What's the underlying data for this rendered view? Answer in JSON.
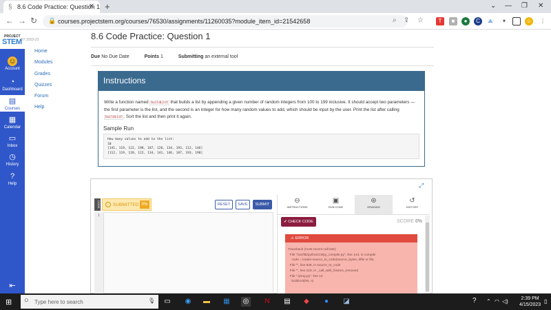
{
  "browser": {
    "tab_title": "8.6 Code Practice: Question 1",
    "url": "courses.projectstem.org/courses/76530/assignments/11260035?module_item_id=21542658"
  },
  "brand": {
    "line1": "PROJECT",
    "line2": "STEM"
  },
  "global_nav": {
    "account": "Account",
    "dashboard": "Dashboard",
    "courses": "Courses",
    "calendar": "Calendar",
    "inbox": "Inbox",
    "history": "History",
    "help": "Help"
  },
  "course_nav": {
    "term": "SY 2022-23",
    "items": [
      "Home",
      "Modules",
      "Grades",
      "Quizzes",
      "Forum",
      "Help"
    ]
  },
  "page": {
    "title": "8.6 Code Practice: Question 1",
    "due_label": "Due",
    "due_value": "No Due Date",
    "points_label": "Points",
    "points_value": "1",
    "submitting_label": "Submitting",
    "submitting_value": "an external tool"
  },
  "instructions": {
    "heading": "Instructions",
    "text_1": "Write a function named",
    "code_1": "buildList",
    "text_2": "that builds a list by appending a given number of random integers from 100 to 199 inclusive. It should accept two parameters — the first parameter is the list, and the second is an integer for how many random values to add, which should be input by the user. Print the list after calling",
    "code_2": "buildList",
    "text_3": ". Sort the list and then print it again.",
    "sample_heading": "Sample Run",
    "sample_output": "How many values to add to the list:\n10\n[141, 119, 122, 198, 187, 120, 134, 193, 112, 146]\n[112, 119, 120, 122, 134, 141, 146, 187, 193, 198]"
  },
  "tool": {
    "side_tab": "CODE",
    "submitted_label": "SUBMITTED",
    "submitted_pct": "0%",
    "reset": "RESET",
    "save": "SAVE",
    "submit": "SUBMIT",
    "line_no": "1",
    "tabs": [
      "INSTRUCTIONS",
      "RUN CODE",
      "GRADING",
      "HISTORY"
    ],
    "check_code": "✔ CHECK CODE",
    "score_label": "SCORE",
    "score_value": "0%",
    "error_heading": "ERROR",
    "error_text": "Traceback (most recent call last):\n  File \"/usr/lib/python3.8/py_compile.py\", line 144, in compile\n    code = loader.source_to_code(source_bytes, dfile or file,\n  File \"\", line 848, in source_to_code\n  File \"\", line 219, in _call_with_frames_removed\n  File \"./prog.py\", line 14\n    buildList(list, n)"
  },
  "taskbar": {
    "search_placeholder": "Type here to search",
    "time": "2:39 PM",
    "date": "4/15/2023"
  }
}
